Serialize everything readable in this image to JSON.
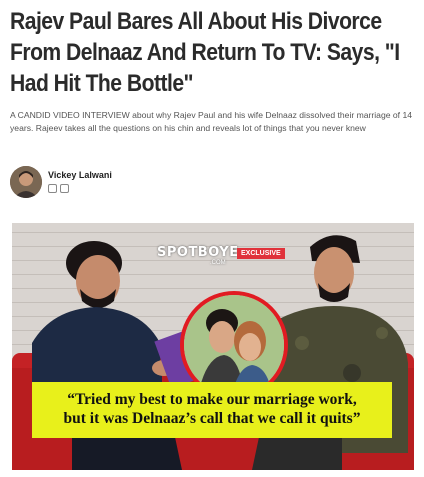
{
  "article": {
    "headline": "Rajev Paul Bares All About His Divorce From Delnaaz And Return To TV: Says, \"I Had Hit The Bottle\"",
    "summary": "A CANDID VIDEO INTERVIEW about why Rajev Paul and his wife Delnaaz dissolved their marriage of 14 years. Rajeev takes all the questions on his chin and reveals lot of things that you never knew"
  },
  "author": {
    "name": "Vickey Lalwani",
    "icons": [
      "mail-icon",
      "twitter-icon"
    ]
  },
  "video": {
    "brand": "SPOTBOYE",
    "brand_sub": ".COM",
    "badge": "EXCLUSIVE",
    "caption_line1": "“Tried my best to make our marriage work,",
    "caption_line2": "but it was Delnaaz’s call that we call it quits”",
    "colors": {
      "badge": "#e0323b",
      "caption_bg": "#e8f01b",
      "couch": "#b81d1f",
      "ring": "#e11b22"
    }
  }
}
